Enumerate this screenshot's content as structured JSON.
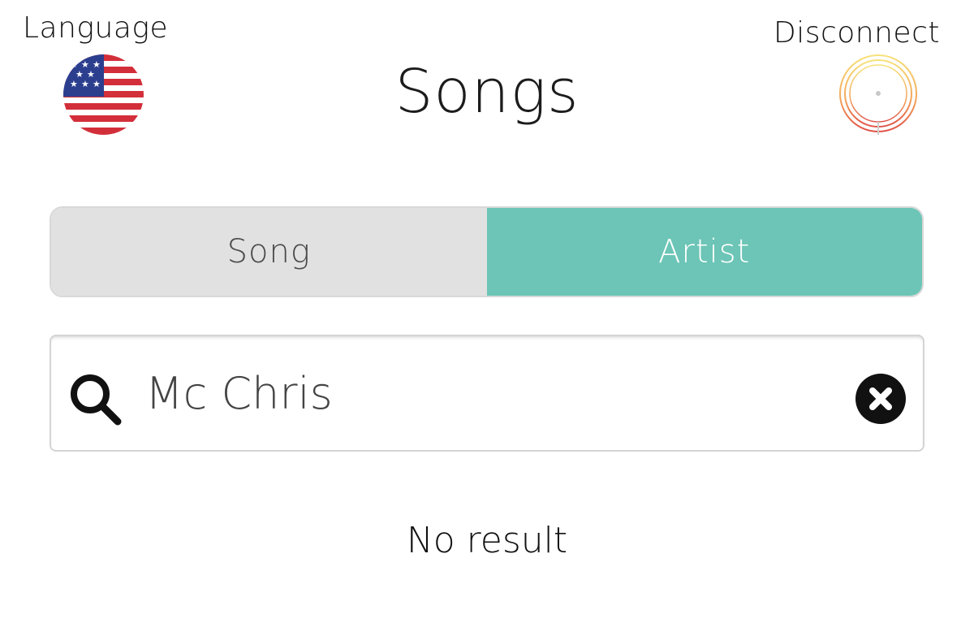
{
  "header": {
    "language_label": "Language",
    "disconnect_label": "Disconnect",
    "title": "Songs",
    "language_flag_icon": "us-flag-icon",
    "disconnect_icon": "power-icon"
  },
  "segment": {
    "song_label": "Song",
    "artist_label": "Artist",
    "selected": "Artist"
  },
  "search": {
    "value": "Mc Chris",
    "icon": "search-icon",
    "clear_icon": "clear-icon"
  },
  "results": {
    "empty_message": "No result"
  },
  "colors": {
    "accent": "#6cc5b6",
    "inactive_segment": "#e1e1e1"
  }
}
